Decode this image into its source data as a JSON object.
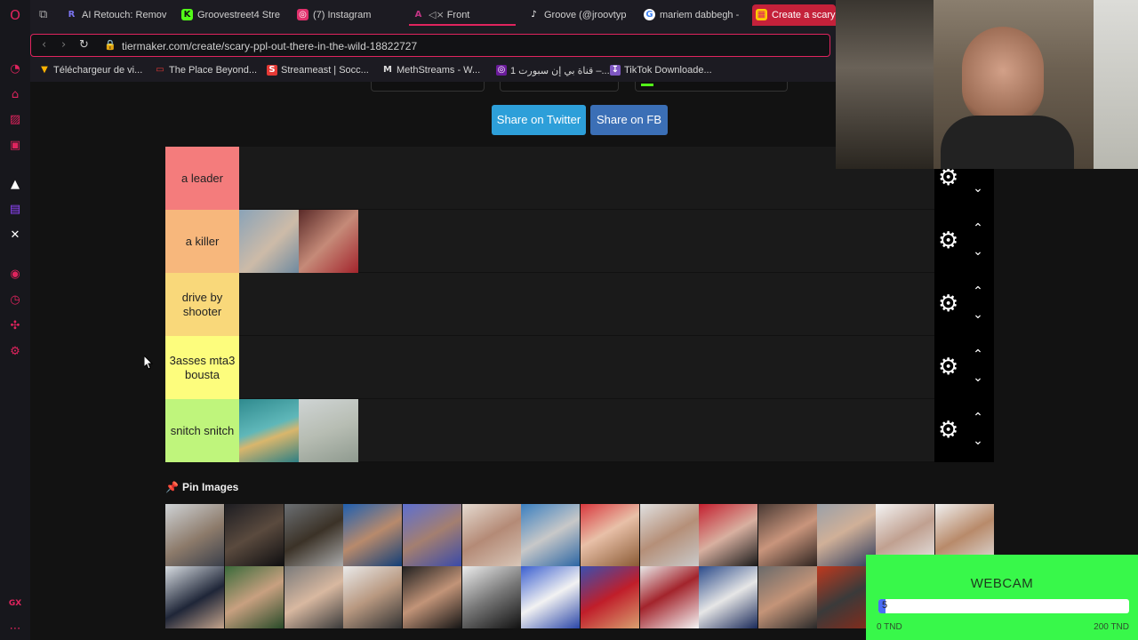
{
  "tabs": [
    {
      "label": "AI Retouch: Remov",
      "icon": "R",
      "color": "#5a4fcf"
    },
    {
      "label": "Groovestreet4 Stre",
      "icon": "K",
      "color": "#53fc18"
    },
    {
      "label": "(7) Instagram",
      "icon": "◎",
      "color": "#e1306c"
    },
    {
      "label": "Front",
      "icon": "A",
      "color": "#c13584",
      "muted": "◁×"
    },
    {
      "label": "Groove (@jroovtyp",
      "icon": "♪",
      "color": "#ffffff"
    },
    {
      "label": "mariem dabbegh -",
      "icon": "G",
      "color": "#4285f4"
    },
    {
      "label": "Create a scary",
      "icon": "▦",
      "color": "#ffcc00"
    }
  ],
  "address": {
    "url": "tiermaker.com/create/scary-ppl-out-there-in-the-wild-18822727"
  },
  "bookmarks": [
    {
      "label": "Téléchargeur de vi...",
      "icon": "▼",
      "color": "#ffb300"
    },
    {
      "label": "The Place Beyond...",
      "icon": "▭",
      "color": "#e53935"
    },
    {
      "label": "Streameast | Socc...",
      "icon": "S",
      "color": "#e53935"
    },
    {
      "label": "MethStreams - W...",
      "icon": "M",
      "color": "#dddddd"
    },
    {
      "label": "قناة بي إن سبورت 1 –...",
      "icon": "◎",
      "color": "#6a1b9a"
    },
    {
      "label": "TikTok Downloade...",
      "icon": "↧",
      "color": "#7e57c2"
    }
  ],
  "share": {
    "twitter_label": "Share on Twitter",
    "fb_label": "Share on FB",
    "twitter_color": "#2d9fd9",
    "fb_color": "#3b6fb6"
  },
  "tiers": [
    {
      "label": "a leader",
      "color": "#f47c7c",
      "images": 0
    },
    {
      "label": "a killer",
      "color": "#f7b77c",
      "images": 2
    },
    {
      "label": "drive by shooter",
      "color": "#f9d87a",
      "images": 0
    },
    {
      "label": "3asses mta3 bousta",
      "color": "#fdfd7d",
      "images": 0
    },
    {
      "label": "snitch snitch",
      "color": "#bff57c",
      "images": 2
    }
  ],
  "pin_images_label": "Pin Images",
  "webcam": {
    "title": "WEBCAM",
    "bar_value": "5",
    "progress": 0.025,
    "min_label": "0 TND",
    "max_label": "200 TND"
  },
  "icons": {
    "gear": "gear-icon",
    "up": "chevron-up-icon",
    "down": "chevron-down-icon"
  }
}
